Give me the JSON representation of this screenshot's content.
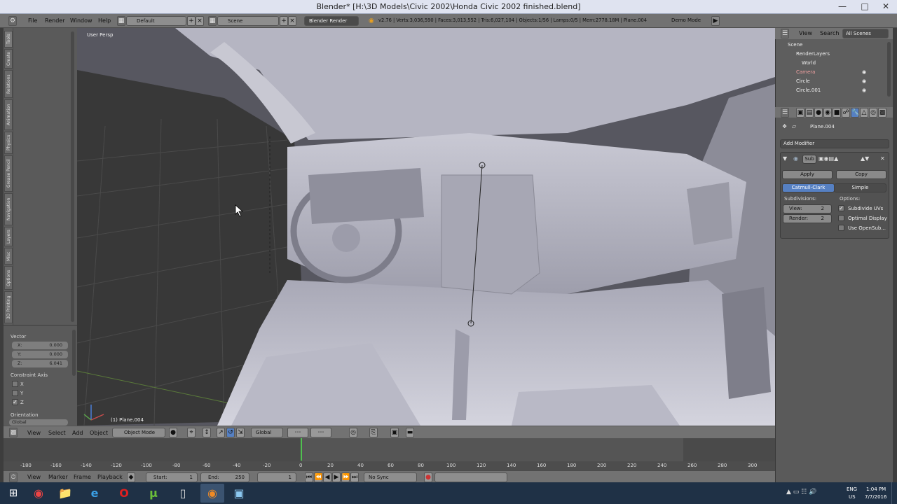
{
  "window": {
    "title": "Blender* [H:\\3D Models\\Civic 2002\\Honda Civic 2002 finished.blend]"
  },
  "info_header": {
    "menus": [
      "File",
      "Render",
      "Window",
      "Help"
    ],
    "layout": "Default",
    "scene": "Scene",
    "engine": "Blender Render",
    "stats": "v2.76 | Verts:3,036,590 | Faces:3,013,552 | Tris:6,027,104 | Objects:1/56 | Lamps:0/5 | Mem:2778.18M | Plane.004",
    "demo": "Demo Mode"
  },
  "toolshelf": {
    "tabs": [
      "Tools",
      "Create",
      "Relations",
      "Animation",
      "Physics",
      "Grease Pencil",
      "Navigation",
      "Layers",
      "Misc",
      "Options",
      "3D Printing"
    ]
  },
  "operator_panel": {
    "vector_label": "Vector",
    "x": {
      "label": "X:",
      "value": "0.000"
    },
    "y": {
      "label": "Y:",
      "value": "0.000"
    },
    "z": {
      "label": "Z:",
      "value": "6.041"
    },
    "constraint_label": "Constraint Axis",
    "cx": "X",
    "cy": "Y",
    "cz": "Z",
    "orientation_label": "Orientation",
    "orientation_value": "Global"
  },
  "viewport": {
    "view_name": "User Persp",
    "object_name": "(1) Plane.004"
  },
  "view3d_header": {
    "menus": [
      "View",
      "Select",
      "Add",
      "Object"
    ],
    "mode": "Object Mode",
    "orientation": "Global"
  },
  "timeline": {
    "ticks": [
      "-180",
      "-160",
      "-140",
      "-120",
      "-100",
      "-80",
      "-60",
      "-40",
      "-20",
      "0",
      "20",
      "40",
      "60",
      "80",
      "100",
      "120",
      "140",
      "160",
      "180",
      "200",
      "220",
      "240",
      "260",
      "280",
      "300"
    ],
    "menus": [
      "View",
      "Marker",
      "Frame",
      "Playback"
    ],
    "start_label": "Start:",
    "start": "1",
    "end_label": "End:",
    "end": "250",
    "current": "1",
    "sync": "No Sync"
  },
  "outliner": {
    "header": {
      "view": "View",
      "search": "Search",
      "scope": "All Scenes"
    },
    "items": [
      "Scene",
      "RenderLayers",
      "World",
      "Camera",
      "Circle",
      "Circle.001"
    ]
  },
  "properties": {
    "object": "Plane.004",
    "add_modifier": "Add Modifier",
    "modifier_name": "Sub",
    "apply": "Apply",
    "copy": "Copy",
    "catmull": "Catmull-Clark",
    "simple": "Simple",
    "subdivisions": "Subdivisions:",
    "options": "Options:",
    "view_label": "View:",
    "view_value": "2",
    "render_label": "Render:",
    "render_value": "2",
    "subdivide_uvs": "Subdivide UVs",
    "optimal_display": "Optimal Display",
    "use_opensubdiv": "Use OpenSub..."
  },
  "taskbar": {
    "lang": "ENG",
    "region": "US",
    "time": "1:04 PM",
    "date": "7/7/2016"
  }
}
